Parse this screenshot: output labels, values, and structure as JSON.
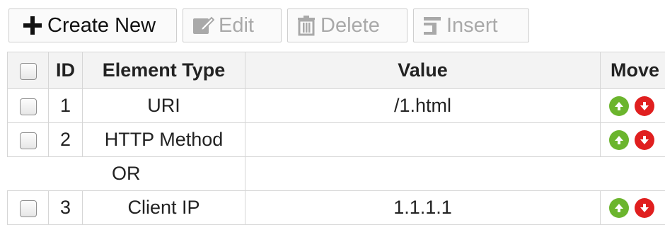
{
  "toolbar": {
    "create_label": "Create New",
    "edit_label": "Edit",
    "delete_label": "Delete",
    "insert_label": "Insert"
  },
  "table": {
    "headers": {
      "id": "ID",
      "type": "Element Type",
      "value": "Value",
      "move": "Move"
    },
    "rows": [
      {
        "id": "1",
        "type": "URI",
        "value": "/1.html"
      },
      {
        "id": "2",
        "type": "HTTP Method",
        "value": ""
      },
      {
        "id": "3",
        "type": "Client IP",
        "value": "1.1.1.1"
      }
    ],
    "separator_label": "OR"
  },
  "colors": {
    "up": "#6bb52d",
    "down": "#e01f1f",
    "header_bg": "#f3f3f3"
  },
  "icons": [
    "plus-icon",
    "edit-icon",
    "trash-icon",
    "insert-icon",
    "arrow-up-icon",
    "arrow-down-icon"
  ]
}
